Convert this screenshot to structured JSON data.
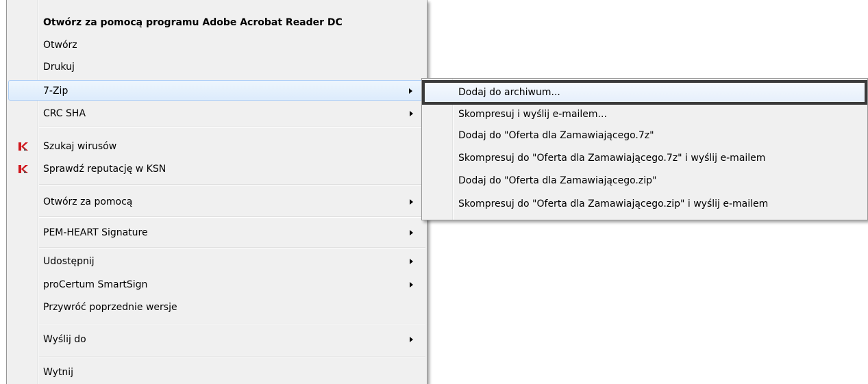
{
  "main_menu": {
    "open_with_acrobat": "Otwórz za pomocą programu Adobe Acrobat Reader DC",
    "open": "Otwórz",
    "print": "Drukuj",
    "seven_zip": "7-Zip",
    "crc_sha": "CRC SHA",
    "scan_viruses": "Szukaj wirusów",
    "check_reputation": "Sprawdź reputację w KSN",
    "open_with": "Otwórz za pomocą",
    "pem_heart": "PEM-HEART Signature",
    "share": "Udostępnij",
    "procertum": "proCertum SmartSign",
    "restore_versions": "Przywróć poprzednie wersje",
    "send_to": "Wyślij do",
    "cut": "Wytnij"
  },
  "submenu_7zip": {
    "items": [
      "Dodaj do archiwum...",
      "Skompresuj i wyślij e-mailem...",
      "Dodaj do \"Oferta dla Zamawiającego.7z\"",
      "Skompresuj do \"Oferta dla Zamawiającego.7z\" i wyślij e-mailem",
      "Dodaj do \"Oferta dla Zamawiającego.zip\"",
      "Skompresuj do \"Oferta dla Zamawiającego.zip\" i wyślij e-mailem"
    ]
  },
  "icons": {
    "kaspersky": "kaspersky-k-icon",
    "submenu": "chevron-right-icon"
  },
  "colors": {
    "menu_bg": "#f0f0f0",
    "highlight_border": "#aecff7",
    "kaspersky_red": "#d0171d"
  }
}
